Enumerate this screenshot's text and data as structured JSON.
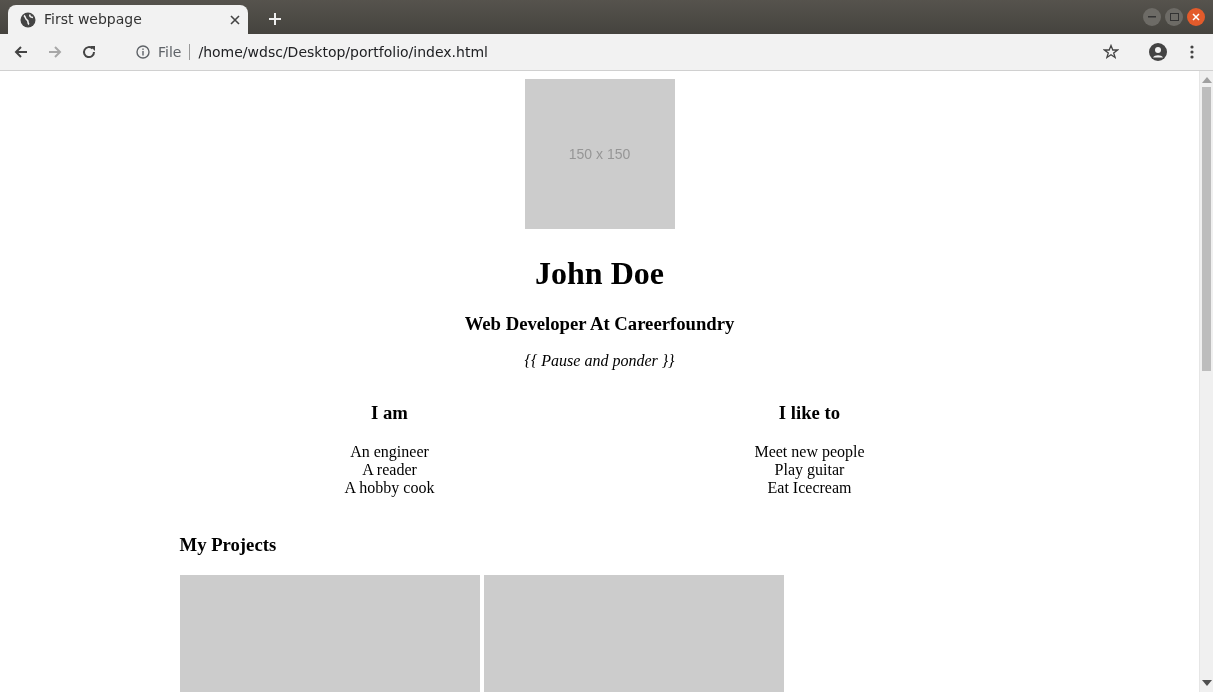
{
  "browser": {
    "tab": {
      "title": "First webpage",
      "selected": true
    },
    "nav": {
      "back_disabled": false,
      "forward_disabled": true
    },
    "address": {
      "scheme_label": "File",
      "url": "/home/wdsc/Desktop/portfolio/index.html"
    }
  },
  "page": {
    "avatar": {
      "label": "150 x 150"
    },
    "name": "John Doe",
    "role": "Web Developer At Careerfoundry",
    "quote": "{{ Pause and ponder }}",
    "columns": [
      {
        "heading": "I am",
        "items": [
          "An engineer",
          "A reader",
          "A hobby cook"
        ]
      },
      {
        "heading": "I like to",
        "items": [
          "Meet new people",
          "Play guitar",
          "Eat Icecream"
        ]
      }
    ],
    "projects_heading": "My Projects",
    "projects": [
      {
        "kind": "placeholder"
      },
      {
        "kind": "placeholder"
      }
    ]
  }
}
